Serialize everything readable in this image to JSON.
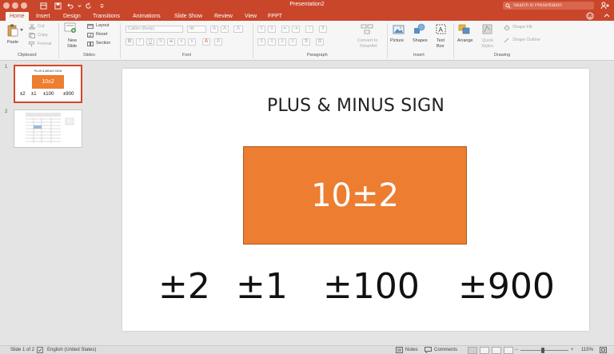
{
  "window": {
    "title": "Presentation2",
    "search_placeholder": "Search in Presentation"
  },
  "tabs": [
    {
      "label": "Home",
      "active": true
    },
    {
      "label": "Insert"
    },
    {
      "label": "Design"
    },
    {
      "label": "Transitions"
    },
    {
      "label": "Animations"
    },
    {
      "label": "Slide Show"
    },
    {
      "label": "Review"
    },
    {
      "label": "View"
    },
    {
      "label": "FPPT"
    }
  ],
  "ribbon": {
    "clipboard": {
      "paste": "Paste",
      "cut": "Cut",
      "copy": "Copy",
      "format": "Format",
      "group": "Clipboard"
    },
    "slides": {
      "new_slide_1": "New",
      "new_slide_2": "Slide",
      "layout": "Layout",
      "reset": "Reset",
      "section": "Section",
      "group": "Slides"
    },
    "font": {
      "family": "Calibri (Body)",
      "size": "96",
      "group": "Font"
    },
    "paragraph": {
      "convert_1": "Convert to",
      "convert_2": "SmartArt",
      "group": "Paragraph"
    },
    "insert": {
      "picture": "Picture",
      "shapes": "Shapes",
      "textbox_1": "Text",
      "textbox_2": "Box",
      "group": "Insert"
    },
    "drawing": {
      "arrange": "Arrange",
      "quick_1": "Quick",
      "quick_2": "Styles",
      "shape_fill": "Shape Fill",
      "shape_outline": "Shape Outline",
      "group": "Drawing"
    }
  },
  "thumbnails": [
    {
      "number": "1",
      "title": "PLUS & MINUS SIGN",
      "box": "10±2",
      "items": [
        "±2",
        "±1",
        "±100",
        "±900"
      ]
    },
    {
      "number": "2"
    }
  ],
  "slide": {
    "title": "PLUS & MINUS SIGN",
    "box_text": "10±2",
    "items": [
      "±2",
      "±1",
      "±100",
      "±900"
    ]
  },
  "status": {
    "slide_of": "Slide 1 of 2",
    "language": "English (United States)",
    "notes": "Notes",
    "comments": "Comments",
    "zoom": "115%",
    "zoom_level": 115
  },
  "colors": {
    "accent": "#c9462b",
    "shape": "#ed7d31"
  }
}
